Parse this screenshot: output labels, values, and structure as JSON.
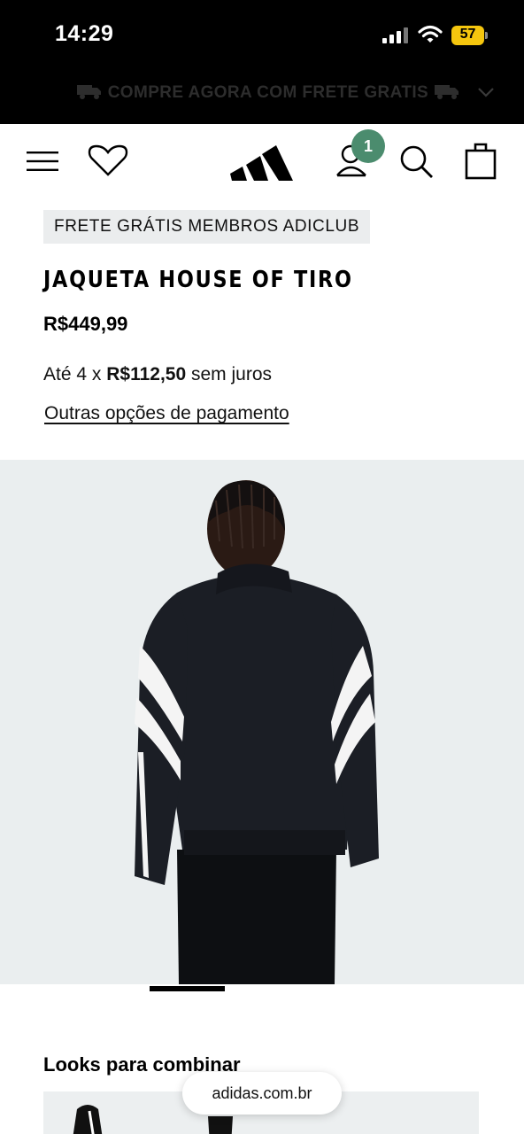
{
  "status_bar": {
    "time": "14:29",
    "battery_level": "57",
    "icons": [
      "signal-icon",
      "wifi-icon",
      "battery-icon"
    ]
  },
  "promo_banner": {
    "text": "COMPRE AGORA COM FRETE GRATIS",
    "icons": [
      "truck-icon",
      "chevron-down-icon"
    ]
  },
  "header": {
    "icons": [
      "menu-icon",
      "heart-icon",
      "adidas-logo",
      "account-icon",
      "search-icon",
      "bag-icon"
    ],
    "account_badge": "1",
    "badge_color": "#4b8c6e"
  },
  "product": {
    "tag": "FRETE GRÁTIS MEMBROS ADICLUB",
    "title": "JAQUETA HOUSE OF TIRO",
    "price": "R$449,99",
    "installments_prefix": "Até 4 x",
    "installments_amount": "R$112,50",
    "installments_suffix": "sem juros",
    "payment_link": "Outras opções de pagamento"
  },
  "looks": {
    "title": "Looks para combinar"
  },
  "browser": {
    "url": "adidas.com.br"
  }
}
